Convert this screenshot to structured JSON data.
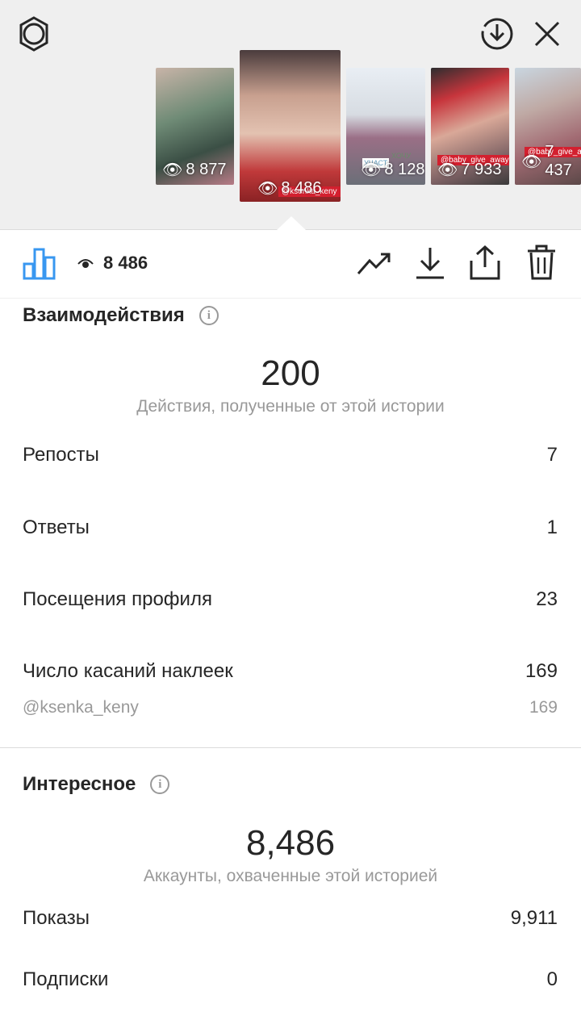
{
  "header": {
    "thumbnails": [
      {
        "views": "8 877"
      },
      {
        "views": "8 486",
        "tag": "@ksenka_keny"
      },
      {
        "views": "8 128",
        "sticker_left": "УЧАСТ",
        "sticker_right": "ХОЧУ"
      },
      {
        "views": "7 933",
        "tag": "@baby_give_away"
      },
      {
        "views": "7 437",
        "tag": "@baby_give_away"
      }
    ]
  },
  "toolbar": {
    "views_count": "8 486"
  },
  "interactions": {
    "title": "Взаимодействия",
    "total": "200",
    "caption": "Действия, полученные от этой истории",
    "rows": [
      {
        "label": "Репосты",
        "value": "7"
      },
      {
        "label": "Ответы",
        "value": "1"
      },
      {
        "label": "Посещения профиля",
        "value": "23"
      },
      {
        "label": "Число касаний наклеек",
        "value": "169"
      }
    ],
    "sticker_row": {
      "label": "@ksenka_keny",
      "value": "169"
    }
  },
  "discovery": {
    "title": "Интересное",
    "total": "8,486",
    "caption": "Аккаунты, охваченные этой историей",
    "rows": [
      {
        "label": "Показы",
        "value": "9,911"
      },
      {
        "label": "Подписки",
        "value": "0"
      }
    ]
  },
  "colors": {
    "accent": "#3897f0",
    "header_bg": "#efefef",
    "muted_text": "#999999"
  }
}
